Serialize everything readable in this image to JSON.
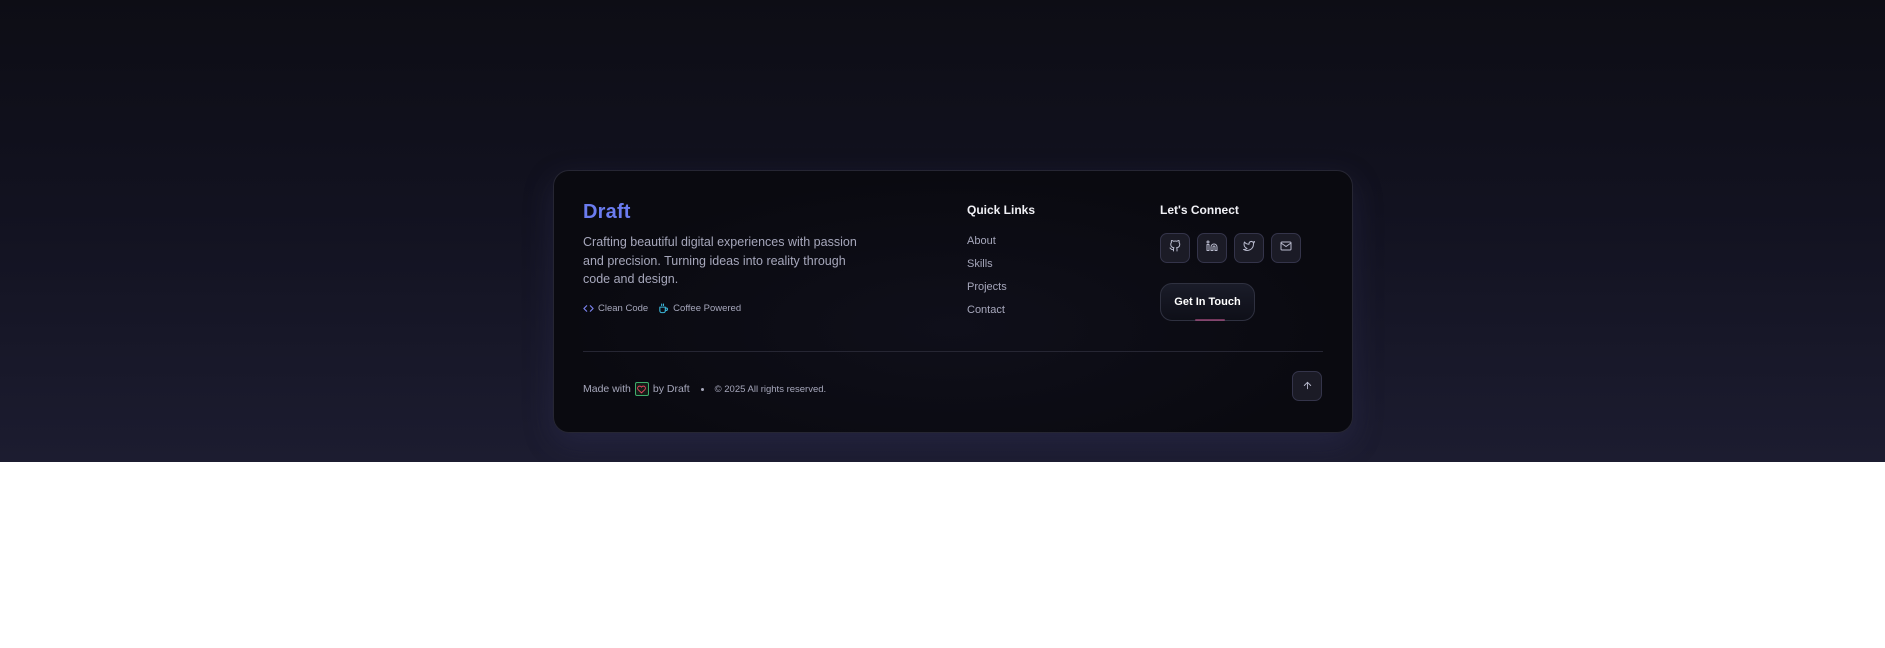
{
  "brand": {
    "name": "Draft",
    "tagline": "Crafting beautiful digital experiences with passion and precision. Turning ideas into reality through code and design.",
    "badges": [
      {
        "label": "Clean Code",
        "icon": "code-icon"
      },
      {
        "label": "Coffee Powered",
        "icon": "coffee-icon"
      }
    ]
  },
  "quick_links": {
    "title": "Quick Links",
    "items": [
      "About",
      "Skills",
      "Projects",
      "Contact"
    ]
  },
  "connect": {
    "title": "Let's Connect",
    "socials": [
      "github-icon",
      "linkedin-icon",
      "twitter-icon",
      "mail-icon"
    ],
    "cta_label": "Get In Touch"
  },
  "bottom": {
    "made_with": "Made with",
    "by": "by Draft",
    "copyright": "© 2025 All rights reserved."
  },
  "colors": {
    "accent": "#6b7cf0",
    "text_muted": "#a6a7bb",
    "heading": "#f1f1f6",
    "badge_code": "#7c83ef",
    "badge_coffee": "#3bb7d9",
    "heart": "#e0455f"
  }
}
